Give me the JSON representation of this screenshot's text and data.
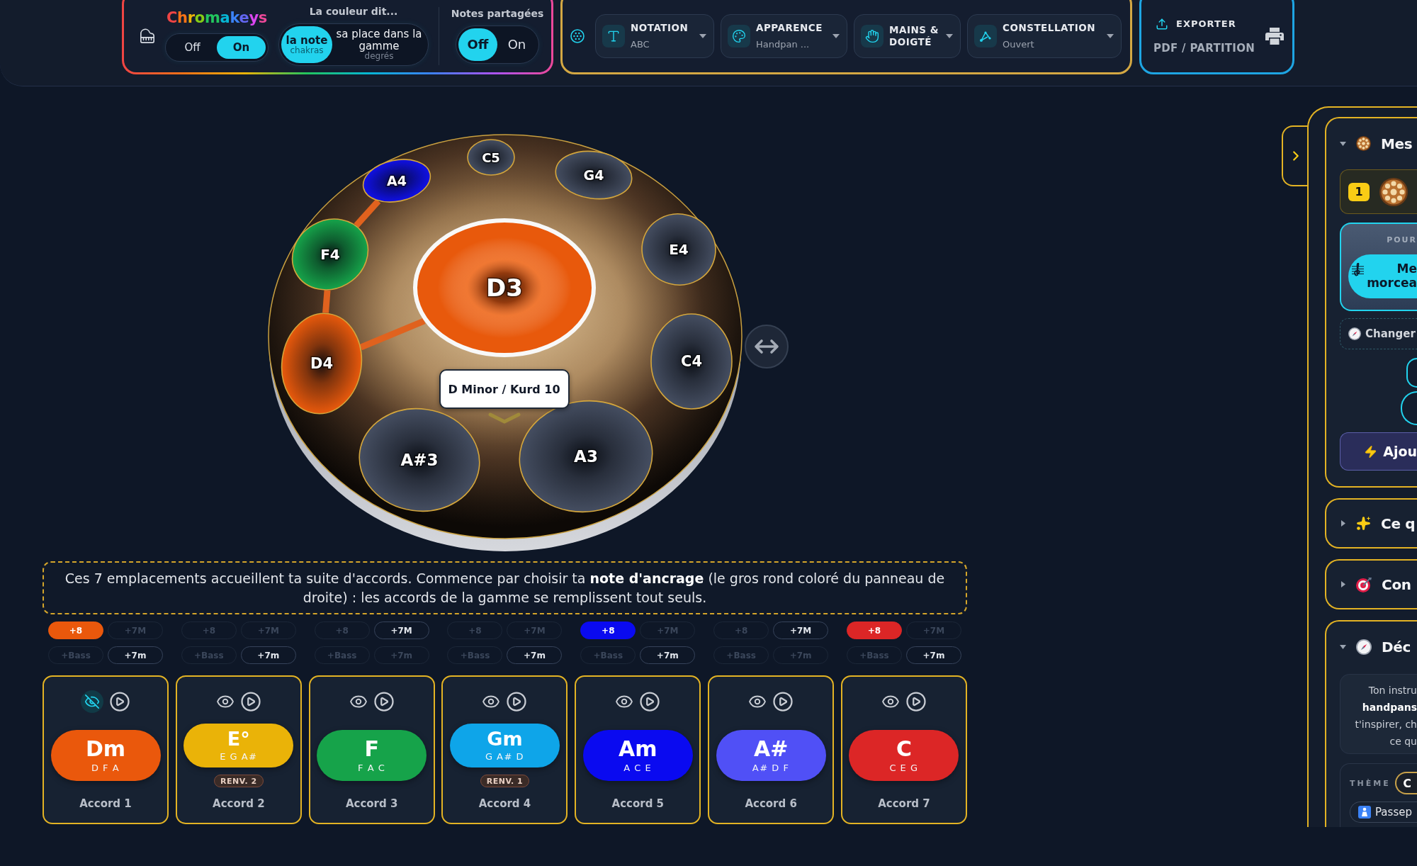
{
  "toolbar": {
    "chromakeys": {
      "title": "Chromakeys",
      "options": [
        {
          "label": "Off",
          "selected": false
        },
        {
          "label": "On",
          "selected": true
        }
      ]
    },
    "color_mode": {
      "title": "La couleur dit...",
      "options": [
        {
          "label": "la note",
          "sublabel": "chakras",
          "selected": true
        },
        {
          "label": "sa place dans la gamme",
          "sublabel": "degrés",
          "selected": false
        }
      ]
    },
    "shared_notes": {
      "title": "Notes partagées",
      "options": [
        {
          "label": "Off",
          "selected": true
        },
        {
          "label": "On",
          "selected": false
        }
      ]
    },
    "menus": [
      {
        "label": "NOTATION",
        "value": "ABC"
      },
      {
        "label": "APPARENCE",
        "value": "Handpan ..."
      },
      {
        "label": "MAINS & DOIGTÉ"
      },
      {
        "label": "CONSTELLATION",
        "value": "Ouvert"
      }
    ],
    "export": {
      "title": "EXPORTER",
      "subtitle": "PDF / PARTITION"
    }
  },
  "handpan": {
    "scale": "D Minor / Kurd 10",
    "notes": [
      {
        "name": "D3",
        "color": "#e8590c",
        "selected": true,
        "linked": true
      },
      {
        "name": "A3",
        "color": "#454e61",
        "selected": false,
        "linked": false
      },
      {
        "name": "A#3",
        "color": "#454e61",
        "selected": false,
        "linked": false
      },
      {
        "name": "C4",
        "color": "#454e61",
        "selected": false,
        "linked": false
      },
      {
        "name": "D4",
        "color": "#e8590c",
        "selected": false,
        "linked": true
      },
      {
        "name": "E4",
        "color": "#454e61",
        "selected": false,
        "linked": false
      },
      {
        "name": "F4",
        "color": "#16a34a",
        "selected": false,
        "linked": true
      },
      {
        "name": "G4",
        "color": "#454e61",
        "selected": false,
        "linked": false
      },
      {
        "name": "A4",
        "color": "#1010e8",
        "selected": false,
        "linked": true
      },
      {
        "name": "C5",
        "color": "#454e61",
        "selected": false,
        "linked": false
      }
    ]
  },
  "hint": "Ces 7 emplacements accueillent ta suite d'accords. Commence par choisir ta **note d'ancrage** (le gros rond coloré du panneau de droite) : les accords de la gamme se remplissent tout seuls.",
  "chords": [
    {
      "name": "Dm",
      "notes": "D F A",
      "color": "#ea580c",
      "label": "Accord 1",
      "hidden": true,
      "chips": [
        {
          "label": "+8",
          "on": true,
          "disabled": false
        },
        {
          "label": "+7M",
          "on": false,
          "disabled": true
        },
        {
          "label": "+Bass",
          "on": false,
          "disabled": true
        },
        {
          "label": "+7m",
          "on": false,
          "disabled": false
        }
      ]
    },
    {
      "name": "E°",
      "notes": "E G A#",
      "color": "#eab308",
      "inversion": "RENV. 2",
      "label": "Accord 2",
      "hidden": false,
      "chips": [
        {
          "label": "+8",
          "on": false,
          "disabled": true
        },
        {
          "label": "+7M",
          "on": false,
          "disabled": true
        },
        {
          "label": "+Bass",
          "on": false,
          "disabled": true
        },
        {
          "label": "+7m",
          "on": false,
          "disabled": false
        }
      ]
    },
    {
      "name": "F",
      "notes": "F A C",
      "color": "#16a34a",
      "label": "Accord 3",
      "hidden": false,
      "chips": [
        {
          "label": "+8",
          "on": false,
          "disabled": true
        },
        {
          "label": "+7M",
          "on": false,
          "disabled": false
        },
        {
          "label": "+Bass",
          "on": false,
          "disabled": true
        },
        {
          "label": "+7m",
          "on": false,
          "disabled": true
        }
      ]
    },
    {
      "name": "Gm",
      "notes": "G A# D",
      "color": "#0ea5e9",
      "inversion": "RENV. 1",
      "label": "Accord 4",
      "hidden": false,
      "chips": [
        {
          "label": "+8",
          "on": false,
          "disabled": true
        },
        {
          "label": "+7M",
          "on": false,
          "disabled": true
        },
        {
          "label": "+Bass",
          "on": false,
          "disabled": true
        },
        {
          "label": "+7m",
          "on": false,
          "disabled": false
        }
      ]
    },
    {
      "name": "Am",
      "notes": "A C E",
      "color": "#0a0af0",
      "label": "Accord 5",
      "hidden": false,
      "chips": [
        {
          "label": "+8",
          "on": true,
          "disabled": false
        },
        {
          "label": "+7M",
          "on": false,
          "disabled": true
        },
        {
          "label": "+Bass",
          "on": false,
          "disabled": true
        },
        {
          "label": "+7m",
          "on": false,
          "disabled": false
        }
      ]
    },
    {
      "name": "A#",
      "notes": "A# D F",
      "color": "#5050f6",
      "label": "Accord 6",
      "hidden": false,
      "chips": [
        {
          "label": "+8",
          "on": false,
          "disabled": true
        },
        {
          "label": "+7M",
          "on": false,
          "disabled": false
        },
        {
          "label": "+Bass",
          "on": false,
          "disabled": true
        },
        {
          "label": "+7m",
          "on": false,
          "disabled": true
        }
      ]
    },
    {
      "name": "C",
      "notes": "C E G",
      "color": "#dc2626",
      "label": "Accord 7",
      "hidden": false,
      "chips": [
        {
          "label": "+8",
          "on": true,
          "disabled": false
        },
        {
          "label": "+7M",
          "on": false,
          "disabled": true
        },
        {
          "label": "+Bass",
          "on": false,
          "disabled": true
        },
        {
          "label": "+7m",
          "on": false,
          "disabled": false
        }
      ]
    }
  ],
  "side_panel": {
    "sections": [
      {
        "kind": "library",
        "title": "Mes",
        "expanded": true,
        "count": "1",
        "prompt_label": "POUR",
        "prompt_button": "Me\nmorcea",
        "change_label": "Changer",
        "add_button": "Ajou"
      },
      {
        "kind": "plain",
        "title": "Ce q",
        "expanded": false
      },
      {
        "kind": "plain",
        "title": "Con",
        "expanded": false
      },
      {
        "kind": "discover",
        "title": "Déc",
        "expanded": true,
        "text": "Ton instru\n**handpans**\nt'inspirer, ch\nce qu",
        "theme_label": "THÈME",
        "theme_value": "C",
        "passport_button": "Passep"
      }
    ]
  }
}
